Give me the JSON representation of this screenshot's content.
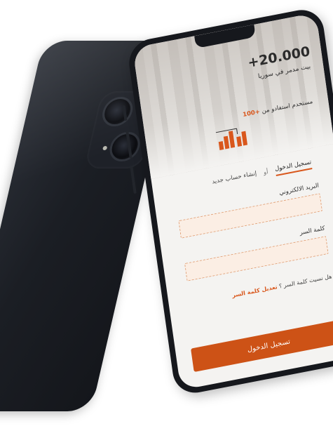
{
  "hero": {
    "stat": "+20.000",
    "subtitle": "بيت مدمر في سوريا",
    "users_prefix": "+100",
    "users_text": "مستخدم استفادو من"
  },
  "tabs": {
    "login": "تسجيل الدخول",
    "separator": "أو",
    "register": "إنشاء حساب جديد"
  },
  "form": {
    "email_label": "البريد الالكتروني",
    "email_value": "",
    "password_label": "كلمة السر",
    "password_value": "",
    "forgot_question": "هل نسيت كلمة السر ؟",
    "forgot_link": "تعديل كلمة السر"
  },
  "submit_label": "تسجيل الدخول",
  "colors": {
    "accent": "#cd5216",
    "input_bg": "#fbeee4",
    "frame": "#16181d"
  }
}
